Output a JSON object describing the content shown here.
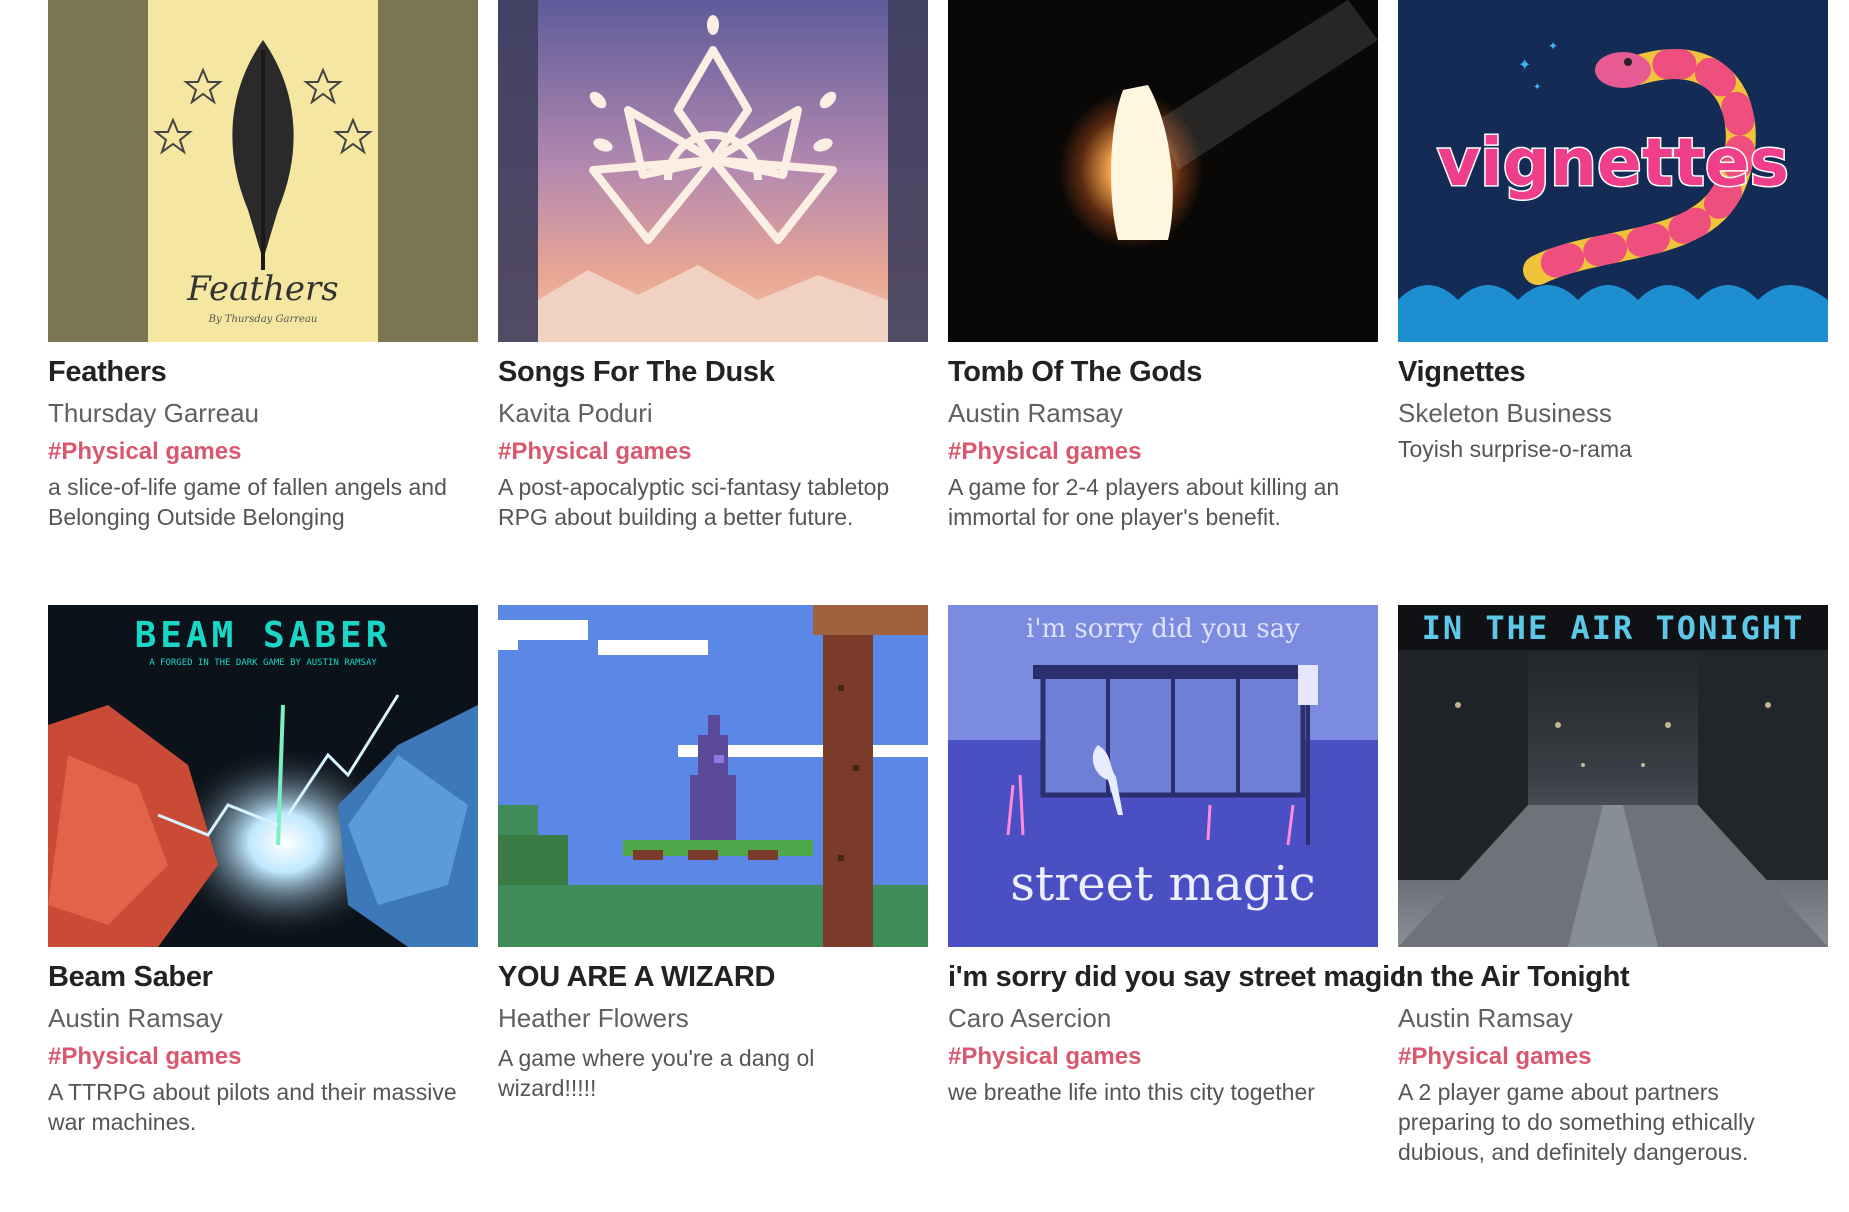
{
  "games": [
    {
      "title": "Feathers",
      "author": "Thursday Garreau",
      "tag": "#Physical games",
      "description": "a slice-of-life game of fallen angels and Belonging Outside Belonging",
      "cover_text": "Feathers",
      "cover_subtext": "By Thursday Garreau"
    },
    {
      "title": "Songs For The Dusk",
      "author": "Kavita Poduri",
      "tag": "#Physical games",
      "description": "A post-apocalyptic sci-fantasy tabletop RPG about building a better future."
    },
    {
      "title": "Tomb Of The Gods",
      "author": "Austin Ramsay",
      "tag": "#Physical games",
      "description": "A game for 2-4 players about killing an immortal for one player's benefit."
    },
    {
      "title": "Vignettes",
      "author": "Skeleton Business",
      "tag": "",
      "description": "Toyish surprise-o-rama",
      "cover_text": "vignettes"
    },
    {
      "title": "Beam Saber",
      "author": "Austin Ramsay",
      "tag": "#Physical games",
      "description": "A TTRPG about pilots and their massive war machines.",
      "cover_text": "BEAM SABER",
      "cover_subtext": "A FORGED IN THE DARK GAME BY AUSTIN RAMSAY"
    },
    {
      "title": "YOU ARE A WIZARD",
      "author": "Heather Flowers",
      "tag": "",
      "description": "A game where you're a dang ol wizard!!!!!"
    },
    {
      "title": "i'm sorry did you say street magic",
      "author": "Caro Asercion",
      "tag": "#Physical games",
      "description": "we breathe life into this city together",
      "cover_text": "street magic",
      "cover_subtext": "i'm sorry did you say"
    },
    {
      "title": "In the Air Tonight",
      "author": "Austin Ramsay",
      "tag": "#Physical games",
      "description": "A 2 player game about partners preparing to do something ethically dubious, and definitely dangerous.",
      "cover_text": "IN THE AIR TONIGHT"
    }
  ]
}
